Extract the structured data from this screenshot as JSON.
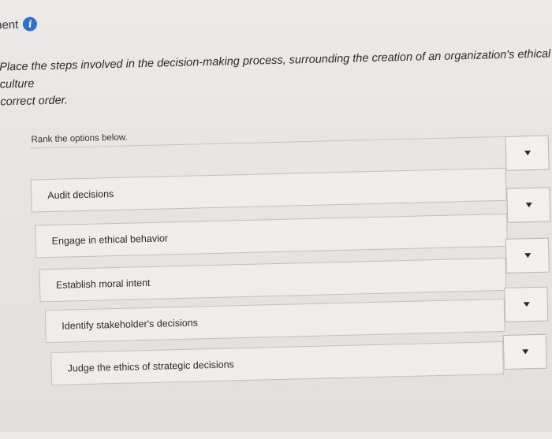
{
  "header": {
    "title": "ment",
    "info_icon": "info-icon"
  },
  "question": {
    "text_line1": "Place the steps involved in the decision-making process, surrounding the creation of an organization's ethical culture",
    "text_line2": "correct order."
  },
  "instructions": "Rank the options below.",
  "options": [
    {
      "label": "Audit decisions"
    },
    {
      "label": "Engage in ethical behavior"
    },
    {
      "label": "Establish moral intent"
    },
    {
      "label": "Identify stakeholder's decisions"
    },
    {
      "label": "Judge the ethics of strategic decisions"
    }
  ],
  "colors": {
    "accent": "#2f6fd0",
    "background": "#e7e5e3",
    "card": "#eeedeb"
  }
}
